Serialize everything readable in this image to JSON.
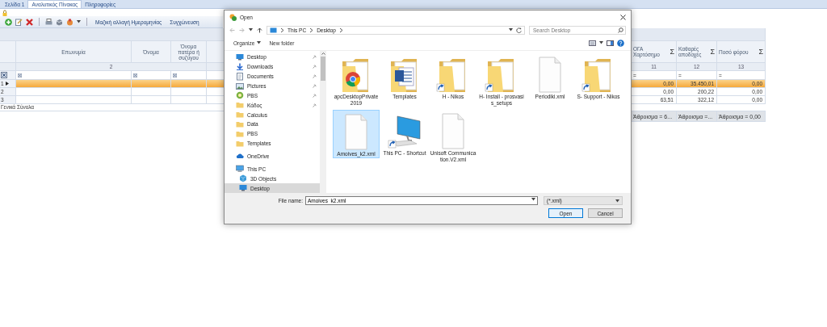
{
  "app": {
    "tabs": [
      {
        "label": "Σελίδα 1",
        "selected": false
      },
      {
        "label": "Αναλυτικός Πίνακας",
        "selected": true
      },
      {
        "label": "Πληροφορίες",
        "selected": false
      }
    ],
    "toolbar": {
      "actions": [
        "Μαζική αλλαγή Ημερομηνίας",
        "Συγχώνευση"
      ]
    },
    "grid": {
      "left_columns": [
        "Επωνυμία",
        "Όνομα",
        "Όνομα πατέρα ή συζύγου"
      ],
      "left_group_number": "2",
      "right_columns": [
        {
          "header": "ΟΓΑ Χαρτόσημο",
          "summary_glyph": "Σ",
          "number": "11",
          "filter_operator": "=",
          "total": "Άθροισμα = 6..."
        },
        {
          "header": "Καθαρές αποδοχές",
          "summary_glyph": "Σ",
          "number": "12",
          "filter_operator": "=",
          "total": "Άθροισμα =..."
        },
        {
          "header": "Ποσό φόρου",
          "summary_glyph": "Σ",
          "number": "13",
          "filter_operator": "=",
          "total": "Άθροισμα = 0,00"
        }
      ],
      "rows": [
        {
          "number": "1",
          "selected": true,
          "values": [
            "0,00",
            "35.450,01",
            "0,00"
          ]
        },
        {
          "number": "2",
          "selected": false,
          "values": [
            "0,00",
            "200,22",
            "0,00"
          ]
        },
        {
          "number": "3",
          "selected": false,
          "values": [
            "63,51",
            "322,12",
            "0,00"
          ]
        }
      ],
      "footer_label": "Γενικά Σύνολα"
    }
  },
  "dialog": {
    "title": "Open",
    "path": [
      "This PC",
      "Desktop"
    ],
    "search_placeholder": "Search Desktop",
    "commands": [
      "Organize",
      "New folder"
    ],
    "nav": [
      {
        "label": "Desktop",
        "kind": "desktop",
        "pinned": true,
        "selected": false
      },
      {
        "label": "Downloads",
        "kind": "download",
        "pinned": true,
        "selected": false
      },
      {
        "label": "Documents",
        "kind": "documents",
        "pinned": true,
        "selected": false
      },
      {
        "label": "Pictures",
        "kind": "pictures",
        "pinned": true,
        "selected": false
      },
      {
        "label": "PBS",
        "kind": "app",
        "pinned": true,
        "selected": false
      },
      {
        "label": "Κάδος",
        "kind": "folder",
        "pinned": true,
        "selected": false
      },
      {
        "label": "Calculus",
        "kind": "folder",
        "pinned": false,
        "selected": false
      },
      {
        "label": "Data",
        "kind": "folder",
        "pinned": false,
        "selected": false
      },
      {
        "label": "PBS",
        "kind": "folder",
        "pinned": false,
        "selected": false
      },
      {
        "label": "Templates",
        "kind": "folder",
        "pinned": false,
        "selected": false
      },
      {
        "label": "OneDrive",
        "kind": "cloud",
        "pinned": false,
        "selected": false
      },
      {
        "label": "This PC",
        "kind": "pc",
        "pinned": false,
        "selected": false,
        "children": [
          {
            "label": "3D Objects",
            "kind": "cube",
            "pinned": false,
            "selected": false
          },
          {
            "label": "Desktop",
            "kind": "desktop",
            "pinned": false,
            "selected": true
          }
        ]
      }
    ],
    "files": [
      {
        "name": "apcDesktopPrivate2019",
        "kind": "chrome-folder",
        "selected": false
      },
      {
        "name": "Templates",
        "kind": "word-folder",
        "selected": false
      },
      {
        "name": "H - Nikos",
        "kind": "folder-shortcut",
        "selected": false
      },
      {
        "name": "H- Install - prosvasis_setups",
        "kind": "folder-shortcut",
        "selected": false
      },
      {
        "name": "Periodiki.xml",
        "kind": "file",
        "selected": false
      },
      {
        "name": "S- Support - Nikos",
        "kind": "folder-shortcut",
        "selected": false
      },
      {
        "name": "Amoives_k2.xml",
        "kind": "file",
        "selected": true
      },
      {
        "name": "This PC - Shortcut",
        "kind": "pc-shortcut",
        "selected": false
      },
      {
        "name": "Unisoft Communication.V2.xml",
        "kind": "file",
        "selected": false
      }
    ],
    "file_name_label": "File name:",
    "file_name": "Amoives_k2.xml",
    "filter": "(*.xml)",
    "buttons": [
      {
        "label": "Open",
        "kind": "primary"
      },
      {
        "label": "Cancel",
        "kind": "normal"
      }
    ]
  }
}
